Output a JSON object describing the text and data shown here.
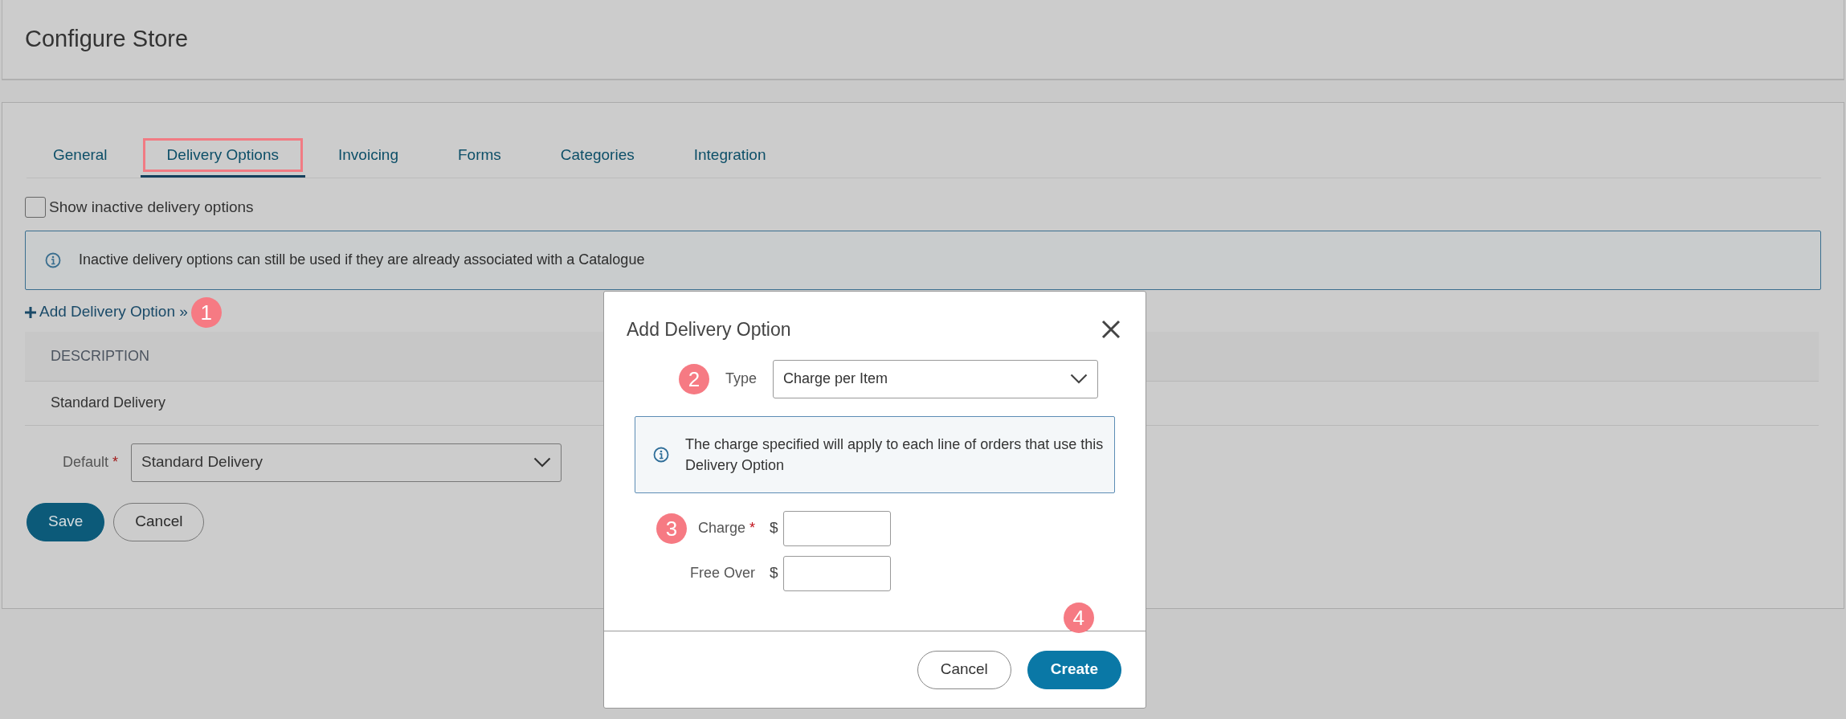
{
  "page": {
    "title": "Configure Store"
  },
  "tabs": [
    {
      "label": "General",
      "selected": false,
      "highlighted": false
    },
    {
      "label": "Delivery Options",
      "selected": true,
      "highlighted": true
    },
    {
      "label": "Invoicing",
      "selected": false,
      "highlighted": false
    },
    {
      "label": "Forms",
      "selected": false,
      "highlighted": false
    },
    {
      "label": "Categories",
      "selected": false,
      "highlighted": false
    },
    {
      "label": "Integration",
      "selected": false,
      "highlighted": false
    }
  ],
  "show_inactive": {
    "label": "Show inactive delivery options",
    "checked": false
  },
  "info": "Inactive delivery options can still be used if they are already associated with a Catalogue",
  "add_link": {
    "label": "Add Delivery Option »",
    "marker": "1"
  },
  "table": {
    "columns": [
      "DESCRIPTION"
    ],
    "rows": [
      [
        "Standard Delivery"
      ]
    ]
  },
  "default_field": {
    "label": "Default",
    "required_mark": "*",
    "value": "Standard Delivery"
  },
  "buttons": [
    {
      "label": "Save",
      "kind": "primary"
    },
    {
      "label": "Cancel",
      "kind": "secondary"
    }
  ],
  "dialog": {
    "title": "Add Delivery Option",
    "type_field": {
      "label": "Type",
      "value": "Charge per Item",
      "marker": "2"
    },
    "info": "The charge specified will apply to each line of orders that use this Delivery Option",
    "amount_fields": [
      {
        "label": "Charge",
        "required": true,
        "currency": "$",
        "marker": "3"
      },
      {
        "label": "Free Over",
        "required": false,
        "currency": "$"
      }
    ],
    "required_mark": "*",
    "buttons": [
      {
        "label": "Cancel",
        "kind": "secondary"
      },
      {
        "label": "Create",
        "kind": "primary",
        "marker": "4"
      }
    ]
  }
}
